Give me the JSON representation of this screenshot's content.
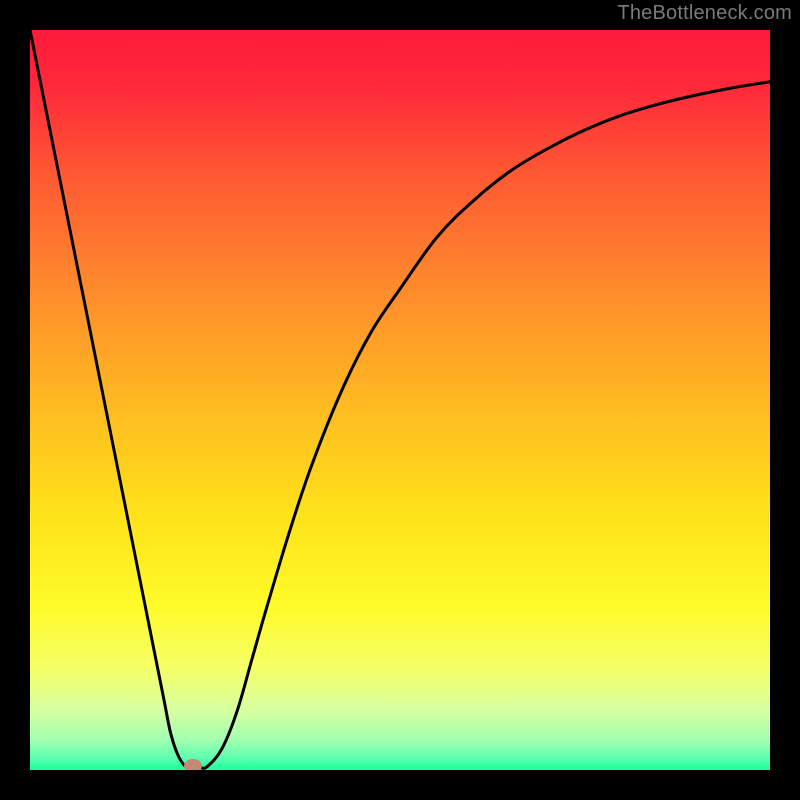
{
  "watermark": "TheBottleneck.com",
  "chart_data": {
    "type": "line",
    "title": "",
    "xlabel": "",
    "ylabel": "",
    "xlim": [
      0,
      100
    ],
    "ylim": [
      0,
      100
    ],
    "grid": false,
    "series": [
      {
        "name": "curve",
        "x": [
          0,
          2,
          4,
          6,
          8,
          10,
          12,
          14,
          16,
          18,
          19,
          20,
          21,
          22,
          23,
          24,
          26,
          28,
          30,
          32,
          35,
          38,
          42,
          46,
          50,
          55,
          60,
          65,
          70,
          75,
          80,
          85,
          90,
          95,
          100
        ],
        "y": [
          100,
          90,
          80,
          70,
          60,
          50,
          40,
          30,
          20,
          10,
          5,
          2,
          0.5,
          0.3,
          0.3,
          0.5,
          3,
          8,
          15,
          22,
          32,
          41,
          51,
          59,
          65,
          72,
          77,
          81,
          84,
          86.5,
          88.5,
          90,
          91.2,
          92.2,
          93
        ]
      }
    ],
    "marker": {
      "x": 22,
      "y": 0.5
    },
    "background_gradient": {
      "stops": [
        {
          "offset": 0.0,
          "color": "#ff1a3a"
        },
        {
          "offset": 0.08,
          "color": "#ff2a3a"
        },
        {
          "offset": 0.2,
          "color": "#ff5a33"
        },
        {
          "offset": 0.35,
          "color": "#ff8b2c"
        },
        {
          "offset": 0.5,
          "color": "#ffb822"
        },
        {
          "offset": 0.65,
          "color": "#ffe11a"
        },
        {
          "offset": 0.78,
          "color": "#fffb2a"
        },
        {
          "offset": 0.86,
          "color": "#f5ff66"
        },
        {
          "offset": 0.92,
          "color": "#d6ffa0"
        },
        {
          "offset": 0.96,
          "color": "#a0ffb0"
        },
        {
          "offset": 0.985,
          "color": "#5affb0"
        },
        {
          "offset": 1.0,
          "color": "#18ff9a"
        }
      ]
    }
  }
}
